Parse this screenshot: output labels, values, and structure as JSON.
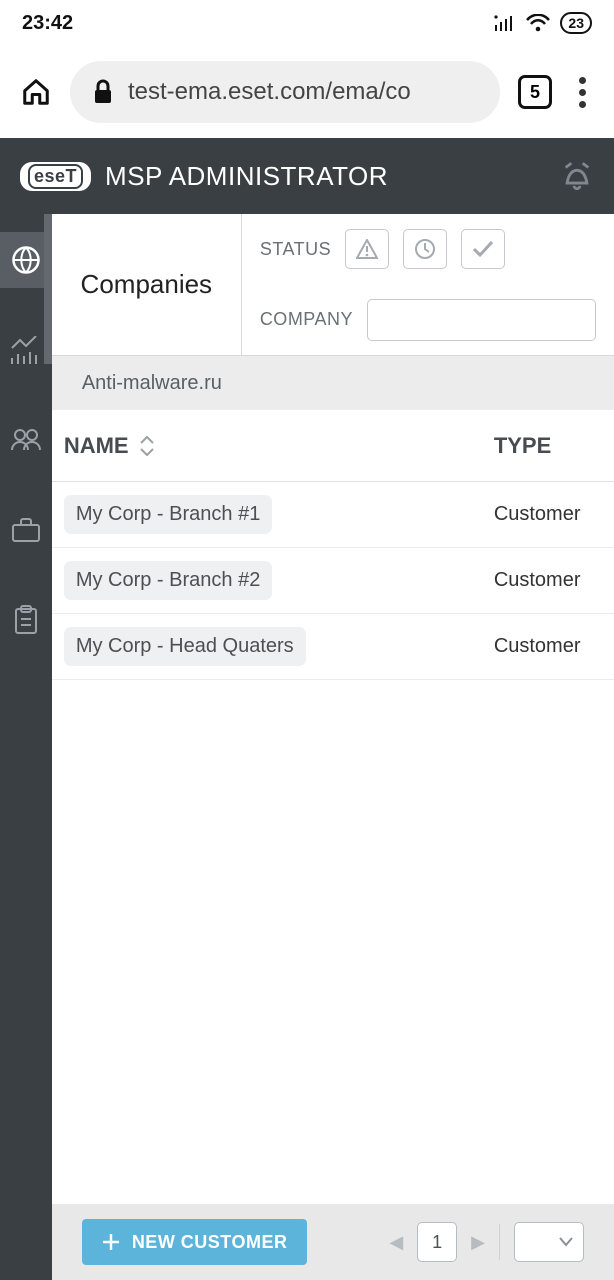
{
  "statusbar": {
    "time": "23:42",
    "battery": "23"
  },
  "browser": {
    "url": "test-ema.eset.com/ema/co",
    "tab_count": "5"
  },
  "app": {
    "brand": "eseT",
    "title": "MSP ADMINISTRATOR"
  },
  "filters": {
    "title": "Companies",
    "status_label": "STATUS",
    "company_label": "COMPANY",
    "company_value": ""
  },
  "breadcrumb": "Anti-malware.ru",
  "table": {
    "columns": {
      "name": "NAME",
      "type": "TYPE"
    },
    "rows": [
      {
        "name": "My Corp - Branch #1",
        "type": "Customer"
      },
      {
        "name": "My Corp - Branch #2",
        "type": "Customer"
      },
      {
        "name": "My Corp - Head Quaters",
        "type": "Customer"
      }
    ]
  },
  "footer": {
    "new_customer": "NEW CUSTOMER",
    "page": "1"
  }
}
